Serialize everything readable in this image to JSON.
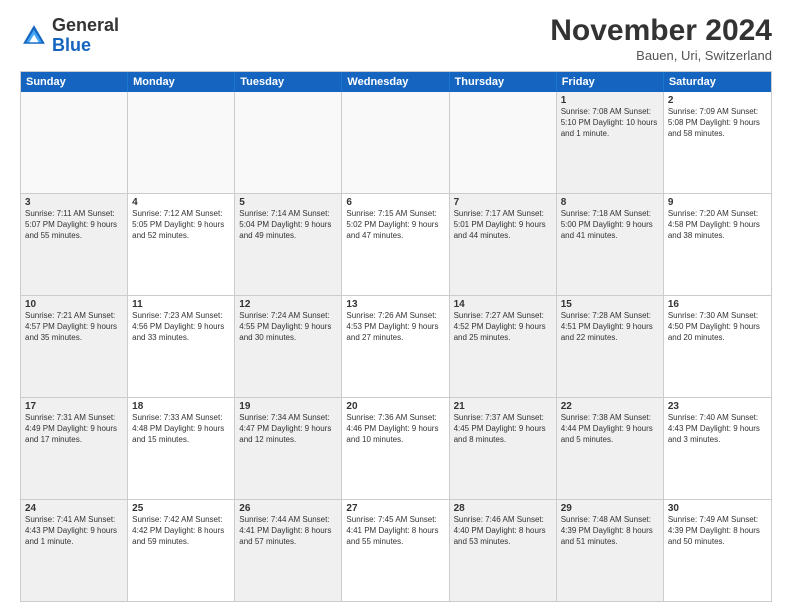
{
  "logo": {
    "general": "General",
    "blue": "Blue"
  },
  "header": {
    "title": "November 2024",
    "location": "Bauen, Uri, Switzerland"
  },
  "weekdays": [
    "Sunday",
    "Monday",
    "Tuesday",
    "Wednesday",
    "Thursday",
    "Friday",
    "Saturday"
  ],
  "rows": [
    [
      {
        "day": "",
        "empty": true
      },
      {
        "day": "",
        "empty": true
      },
      {
        "day": "",
        "empty": true
      },
      {
        "day": "",
        "empty": true
      },
      {
        "day": "",
        "empty": true
      },
      {
        "day": "1",
        "info": "Sunrise: 7:08 AM\nSunset: 5:10 PM\nDaylight: 10 hours and 1 minute.",
        "shaded": true
      },
      {
        "day": "2",
        "info": "Sunrise: 7:09 AM\nSunset: 5:08 PM\nDaylight: 9 hours and 58 minutes.",
        "shaded": false
      }
    ],
    [
      {
        "day": "3",
        "info": "Sunrise: 7:11 AM\nSunset: 5:07 PM\nDaylight: 9 hours and 55 minutes.",
        "shaded": true
      },
      {
        "day": "4",
        "info": "Sunrise: 7:12 AM\nSunset: 5:05 PM\nDaylight: 9 hours and 52 minutes.",
        "shaded": false
      },
      {
        "day": "5",
        "info": "Sunrise: 7:14 AM\nSunset: 5:04 PM\nDaylight: 9 hours and 49 minutes.",
        "shaded": true
      },
      {
        "day": "6",
        "info": "Sunrise: 7:15 AM\nSunset: 5:02 PM\nDaylight: 9 hours and 47 minutes.",
        "shaded": false
      },
      {
        "day": "7",
        "info": "Sunrise: 7:17 AM\nSunset: 5:01 PM\nDaylight: 9 hours and 44 minutes.",
        "shaded": true
      },
      {
        "day": "8",
        "info": "Sunrise: 7:18 AM\nSunset: 5:00 PM\nDaylight: 9 hours and 41 minutes.",
        "shaded": true
      },
      {
        "day": "9",
        "info": "Sunrise: 7:20 AM\nSunset: 4:58 PM\nDaylight: 9 hours and 38 minutes.",
        "shaded": false
      }
    ],
    [
      {
        "day": "10",
        "info": "Sunrise: 7:21 AM\nSunset: 4:57 PM\nDaylight: 9 hours and 35 minutes.",
        "shaded": true
      },
      {
        "day": "11",
        "info": "Sunrise: 7:23 AM\nSunset: 4:56 PM\nDaylight: 9 hours and 33 minutes.",
        "shaded": false
      },
      {
        "day": "12",
        "info": "Sunrise: 7:24 AM\nSunset: 4:55 PM\nDaylight: 9 hours and 30 minutes.",
        "shaded": true
      },
      {
        "day": "13",
        "info": "Sunrise: 7:26 AM\nSunset: 4:53 PM\nDaylight: 9 hours and 27 minutes.",
        "shaded": false
      },
      {
        "day": "14",
        "info": "Sunrise: 7:27 AM\nSunset: 4:52 PM\nDaylight: 9 hours and 25 minutes.",
        "shaded": true
      },
      {
        "day": "15",
        "info": "Sunrise: 7:28 AM\nSunset: 4:51 PM\nDaylight: 9 hours and 22 minutes.",
        "shaded": true
      },
      {
        "day": "16",
        "info": "Sunrise: 7:30 AM\nSunset: 4:50 PM\nDaylight: 9 hours and 20 minutes.",
        "shaded": false
      }
    ],
    [
      {
        "day": "17",
        "info": "Sunrise: 7:31 AM\nSunset: 4:49 PM\nDaylight: 9 hours and 17 minutes.",
        "shaded": true
      },
      {
        "day": "18",
        "info": "Sunrise: 7:33 AM\nSunset: 4:48 PM\nDaylight: 9 hours and 15 minutes.",
        "shaded": false
      },
      {
        "day": "19",
        "info": "Sunrise: 7:34 AM\nSunset: 4:47 PM\nDaylight: 9 hours and 12 minutes.",
        "shaded": true
      },
      {
        "day": "20",
        "info": "Sunrise: 7:36 AM\nSunset: 4:46 PM\nDaylight: 9 hours and 10 minutes.",
        "shaded": false
      },
      {
        "day": "21",
        "info": "Sunrise: 7:37 AM\nSunset: 4:45 PM\nDaylight: 9 hours and 8 minutes.",
        "shaded": true
      },
      {
        "day": "22",
        "info": "Sunrise: 7:38 AM\nSunset: 4:44 PM\nDaylight: 9 hours and 5 minutes.",
        "shaded": true
      },
      {
        "day": "23",
        "info": "Sunrise: 7:40 AM\nSunset: 4:43 PM\nDaylight: 9 hours and 3 minutes.",
        "shaded": false
      }
    ],
    [
      {
        "day": "24",
        "info": "Sunrise: 7:41 AM\nSunset: 4:43 PM\nDaylight: 9 hours and 1 minute.",
        "shaded": true
      },
      {
        "day": "25",
        "info": "Sunrise: 7:42 AM\nSunset: 4:42 PM\nDaylight: 8 hours and 59 minutes.",
        "shaded": false
      },
      {
        "day": "26",
        "info": "Sunrise: 7:44 AM\nSunset: 4:41 PM\nDaylight: 8 hours and 57 minutes.",
        "shaded": true
      },
      {
        "day": "27",
        "info": "Sunrise: 7:45 AM\nSunset: 4:41 PM\nDaylight: 8 hours and 55 minutes.",
        "shaded": false
      },
      {
        "day": "28",
        "info": "Sunrise: 7:46 AM\nSunset: 4:40 PM\nDaylight: 8 hours and 53 minutes.",
        "shaded": true
      },
      {
        "day": "29",
        "info": "Sunrise: 7:48 AM\nSunset: 4:39 PM\nDaylight: 8 hours and 51 minutes.",
        "shaded": true
      },
      {
        "day": "30",
        "info": "Sunrise: 7:49 AM\nSunset: 4:39 PM\nDaylight: 8 hours and 50 minutes.",
        "shaded": false
      }
    ]
  ]
}
